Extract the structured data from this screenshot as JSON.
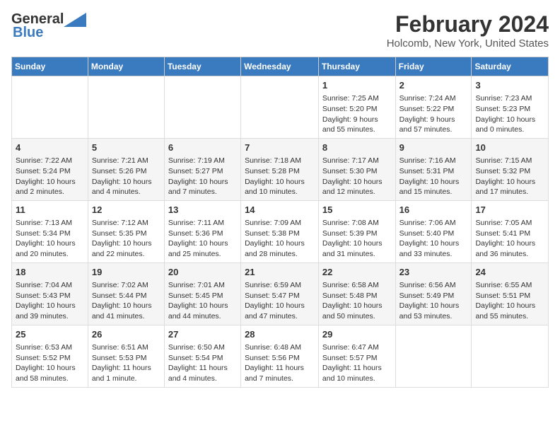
{
  "header": {
    "logo_line1": "General",
    "logo_line2": "Blue",
    "title": "February 2024",
    "subtitle": "Holcomb, New York, United States"
  },
  "days_of_week": [
    "Sunday",
    "Monday",
    "Tuesday",
    "Wednesday",
    "Thursday",
    "Friday",
    "Saturday"
  ],
  "weeks": [
    [
      {
        "day": "",
        "content": ""
      },
      {
        "day": "",
        "content": ""
      },
      {
        "day": "",
        "content": ""
      },
      {
        "day": "",
        "content": ""
      },
      {
        "day": "1",
        "content": "Sunrise: 7:25 AM\nSunset: 5:20 PM\nDaylight: 9 hours and 55 minutes."
      },
      {
        "day": "2",
        "content": "Sunrise: 7:24 AM\nSunset: 5:22 PM\nDaylight: 9 hours and 57 minutes."
      },
      {
        "day": "3",
        "content": "Sunrise: 7:23 AM\nSunset: 5:23 PM\nDaylight: 10 hours and 0 minutes."
      }
    ],
    [
      {
        "day": "4",
        "content": "Sunrise: 7:22 AM\nSunset: 5:24 PM\nDaylight: 10 hours and 2 minutes."
      },
      {
        "day": "5",
        "content": "Sunrise: 7:21 AM\nSunset: 5:26 PM\nDaylight: 10 hours and 4 minutes."
      },
      {
        "day": "6",
        "content": "Sunrise: 7:19 AM\nSunset: 5:27 PM\nDaylight: 10 hours and 7 minutes."
      },
      {
        "day": "7",
        "content": "Sunrise: 7:18 AM\nSunset: 5:28 PM\nDaylight: 10 hours and 10 minutes."
      },
      {
        "day": "8",
        "content": "Sunrise: 7:17 AM\nSunset: 5:30 PM\nDaylight: 10 hours and 12 minutes."
      },
      {
        "day": "9",
        "content": "Sunrise: 7:16 AM\nSunset: 5:31 PM\nDaylight: 10 hours and 15 minutes."
      },
      {
        "day": "10",
        "content": "Sunrise: 7:15 AM\nSunset: 5:32 PM\nDaylight: 10 hours and 17 minutes."
      }
    ],
    [
      {
        "day": "11",
        "content": "Sunrise: 7:13 AM\nSunset: 5:34 PM\nDaylight: 10 hours and 20 minutes."
      },
      {
        "day": "12",
        "content": "Sunrise: 7:12 AM\nSunset: 5:35 PM\nDaylight: 10 hours and 22 minutes."
      },
      {
        "day": "13",
        "content": "Sunrise: 7:11 AM\nSunset: 5:36 PM\nDaylight: 10 hours and 25 minutes."
      },
      {
        "day": "14",
        "content": "Sunrise: 7:09 AM\nSunset: 5:38 PM\nDaylight: 10 hours and 28 minutes."
      },
      {
        "day": "15",
        "content": "Sunrise: 7:08 AM\nSunset: 5:39 PM\nDaylight: 10 hours and 31 minutes."
      },
      {
        "day": "16",
        "content": "Sunrise: 7:06 AM\nSunset: 5:40 PM\nDaylight: 10 hours and 33 minutes."
      },
      {
        "day": "17",
        "content": "Sunrise: 7:05 AM\nSunset: 5:41 PM\nDaylight: 10 hours and 36 minutes."
      }
    ],
    [
      {
        "day": "18",
        "content": "Sunrise: 7:04 AM\nSunset: 5:43 PM\nDaylight: 10 hours and 39 minutes."
      },
      {
        "day": "19",
        "content": "Sunrise: 7:02 AM\nSunset: 5:44 PM\nDaylight: 10 hours and 41 minutes."
      },
      {
        "day": "20",
        "content": "Sunrise: 7:01 AM\nSunset: 5:45 PM\nDaylight: 10 hours and 44 minutes."
      },
      {
        "day": "21",
        "content": "Sunrise: 6:59 AM\nSunset: 5:47 PM\nDaylight: 10 hours and 47 minutes."
      },
      {
        "day": "22",
        "content": "Sunrise: 6:58 AM\nSunset: 5:48 PM\nDaylight: 10 hours and 50 minutes."
      },
      {
        "day": "23",
        "content": "Sunrise: 6:56 AM\nSunset: 5:49 PM\nDaylight: 10 hours and 53 minutes."
      },
      {
        "day": "24",
        "content": "Sunrise: 6:55 AM\nSunset: 5:51 PM\nDaylight: 10 hours and 55 minutes."
      }
    ],
    [
      {
        "day": "25",
        "content": "Sunrise: 6:53 AM\nSunset: 5:52 PM\nDaylight: 10 hours and 58 minutes."
      },
      {
        "day": "26",
        "content": "Sunrise: 6:51 AM\nSunset: 5:53 PM\nDaylight: 11 hours and 1 minute."
      },
      {
        "day": "27",
        "content": "Sunrise: 6:50 AM\nSunset: 5:54 PM\nDaylight: 11 hours and 4 minutes."
      },
      {
        "day": "28",
        "content": "Sunrise: 6:48 AM\nSunset: 5:56 PM\nDaylight: 11 hours and 7 minutes."
      },
      {
        "day": "29",
        "content": "Sunrise: 6:47 AM\nSunset: 5:57 PM\nDaylight: 11 hours and 10 minutes."
      },
      {
        "day": "",
        "content": ""
      },
      {
        "day": "",
        "content": ""
      }
    ]
  ]
}
